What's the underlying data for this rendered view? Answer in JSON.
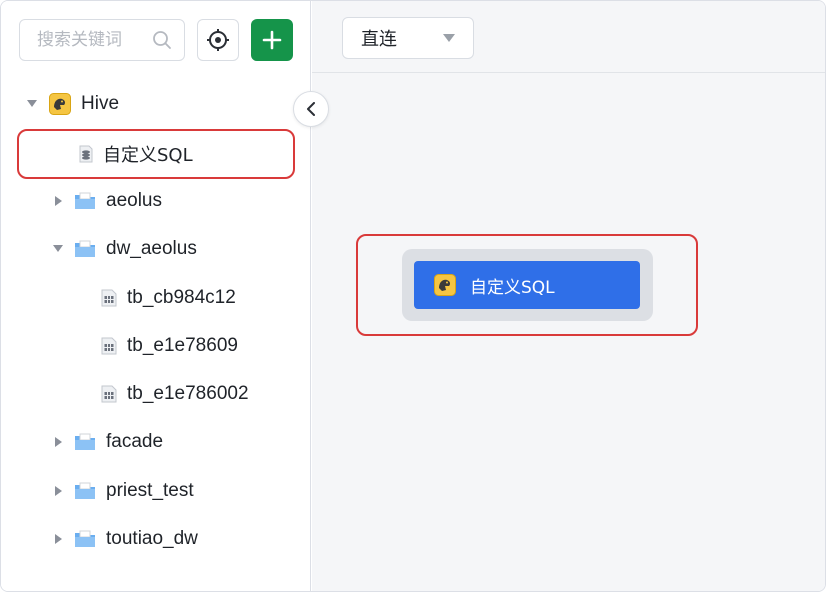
{
  "sidebar": {
    "search": {
      "placeholder": "搜索关键词"
    },
    "tree": [
      {
        "label": "Hive",
        "icon": "hive-icon",
        "expanded": true
      },
      {
        "label": "自定义SQL",
        "icon": "database-stack-icon"
      },
      {
        "label": "aeolus",
        "icon": "folder-icon",
        "expanded": false
      },
      {
        "label": "dw_aeolus",
        "icon": "folder-icon",
        "expanded": true
      },
      {
        "label": "tb_cb984c12",
        "icon": "table-icon"
      },
      {
        "label": "tb_e1e78609",
        "icon": "table-icon"
      },
      {
        "label": "tb_e1e786002",
        "icon": "table-icon"
      },
      {
        "label": "facade",
        "icon": "folder-icon",
        "expanded": false
      },
      {
        "label": "priest_test",
        "icon": "folder-icon",
        "expanded": false
      },
      {
        "label": "toutiao_dw",
        "icon": "folder-icon",
        "expanded": false
      }
    ]
  },
  "main": {
    "mode_select": {
      "value": "直连"
    },
    "canvas_node": {
      "label": "自定义SQL",
      "icon": "hive-icon"
    }
  },
  "colors": {
    "accent_green": "#15944a",
    "node_blue": "#2f6fe8",
    "highlight_red": "#d93a3a"
  }
}
